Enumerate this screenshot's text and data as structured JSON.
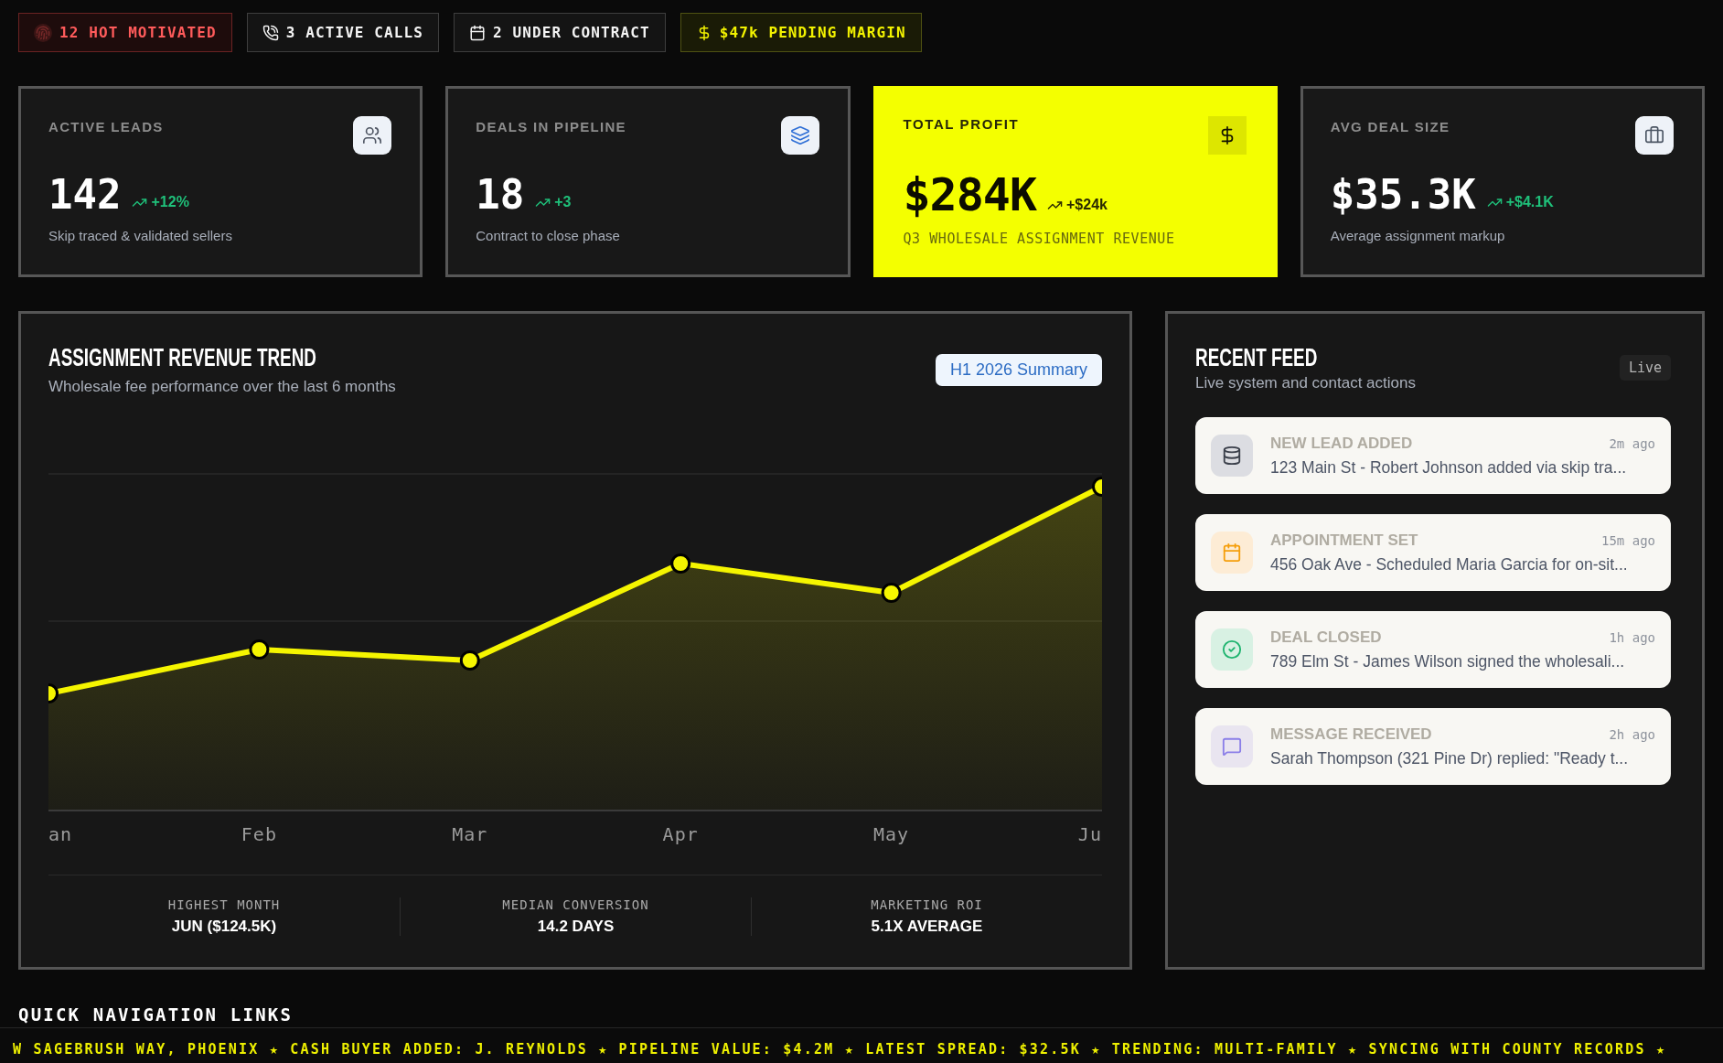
{
  "status_badges": [
    {
      "kind": "hot",
      "label": "12 HOT MOTIVATED"
    },
    {
      "kind": "calls",
      "label": "3 ACTIVE CALLS"
    },
    {
      "kind": "contract",
      "label": "2 UNDER CONTRACT"
    },
    {
      "kind": "margin",
      "label": "$47k PENDING MARGIN"
    }
  ],
  "stat_cards": [
    {
      "kind": "leads",
      "highlighted": false,
      "label": "ACTIVE LEADS",
      "value": "142",
      "delta": "+12%",
      "caption": "Skip traced & validated sellers"
    },
    {
      "kind": "pipeline",
      "highlighted": false,
      "label": "DEALS IN PIPELINE",
      "value": "18",
      "delta": "+3",
      "caption": "Contract to close phase"
    },
    {
      "kind": "profit",
      "highlighted": true,
      "label": "TOTAL PROFIT",
      "value": "$284K",
      "delta": "+$24k",
      "caption": "Q3 WHOLESALE ASSIGNMENT REVENUE"
    },
    {
      "kind": "deal_size",
      "highlighted": false,
      "label": "AVG DEAL SIZE",
      "value": "$35.3K",
      "delta": "+$4.1K",
      "caption": "Average assignment markup"
    }
  ],
  "revenue_panel": {
    "title": "ASSIGNMENT REVENUE TREND",
    "subtitle": "Wholesale fee performance over the last 6 months",
    "summary_button": "H1 2026 Summary",
    "x_labels": [
      "an",
      "Feb",
      "Mar",
      "Apr",
      "May",
      "Ju"
    ],
    "stats": [
      {
        "label": "HIGHEST MONTH",
        "value": "JUN ($124.5K)"
      },
      {
        "label": "MEDIAN CONVERSION",
        "value": "14.2 DAYS"
      },
      {
        "label": "MARKETING ROI",
        "value": "5.1X AVERAGE"
      }
    ]
  },
  "recent_feed": {
    "title": "RECENT FEED",
    "subtitle": "Live system and contact actions",
    "badge": "Live",
    "items": [
      {
        "kind": "lead",
        "title": "NEW LEAD ADDED",
        "time": "2m ago",
        "text": "123 Main St - Robert Johnson added via skip tra..."
      },
      {
        "kind": "appointment",
        "title": "APPOINTMENT SET",
        "time": "15m ago",
        "text": "456 Oak Ave - Scheduled Maria Garcia for on-sit..."
      },
      {
        "kind": "deal",
        "title": "DEAL CLOSED",
        "time": "1h ago",
        "text": "789 Elm St - James Wilson signed the wholesali..."
      },
      {
        "kind": "message",
        "title": "MESSAGE RECEIVED",
        "time": "2h ago",
        "text": "Sarah Thompson (321 Pine Dr) replied: \"Ready t..."
      }
    ]
  },
  "quick_navigation": {
    "title": "QUICK NAVIGATION LINKS"
  },
  "ticker": "W SAGEBRUSH WAY, PHOENIX ★ CASH BUYER ADDED: J. REYNOLDS ★ PIPELINE VALUE: $4.2M ★ LATEST SPREAD: $32.5K ★ TRENDING: MULTI-FAMILY ★ SYNCING WITH COUNTY RECORDS ★"
}
